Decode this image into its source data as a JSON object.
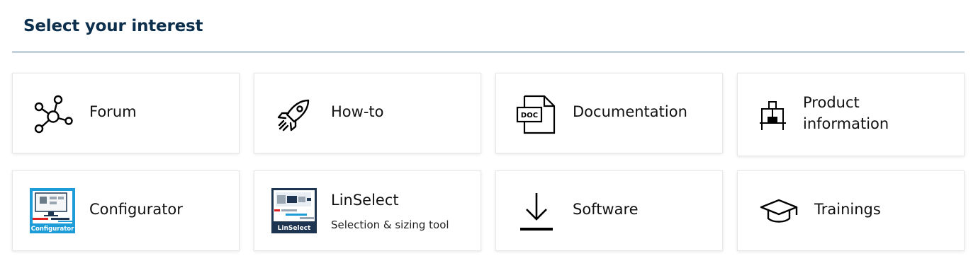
{
  "section": {
    "title": "Select your interest"
  },
  "cards": [
    {
      "label": "Forum",
      "icon": "network-nodes-icon"
    },
    {
      "label": "How-to",
      "icon": "rocket-icon"
    },
    {
      "label": "Documentation",
      "icon": "doc-file-icon",
      "icon_text": "DOC"
    },
    {
      "label": "Product information",
      "label_line1": "Product",
      "label_line2": "information",
      "icon": "machine-icon"
    },
    {
      "label": "Configurator",
      "icon": "configurator-thumbnail",
      "thumb_text": "Configurator"
    },
    {
      "label": "LinSelect",
      "sublabel": "Selection & sizing tool",
      "icon": "linselect-thumbnail",
      "thumb_text": "LinSelect"
    },
    {
      "label": "Software",
      "icon": "download-icon"
    },
    {
      "label": "Trainings",
      "icon": "graduation-cap-icon"
    }
  ],
  "colors": {
    "heading": "#0b2f4d",
    "rule": "#c4d2dc",
    "card_border": "#e6e8ea",
    "thumb_blue": "#1d9cd8",
    "thumb_navy": "#1d3550"
  }
}
